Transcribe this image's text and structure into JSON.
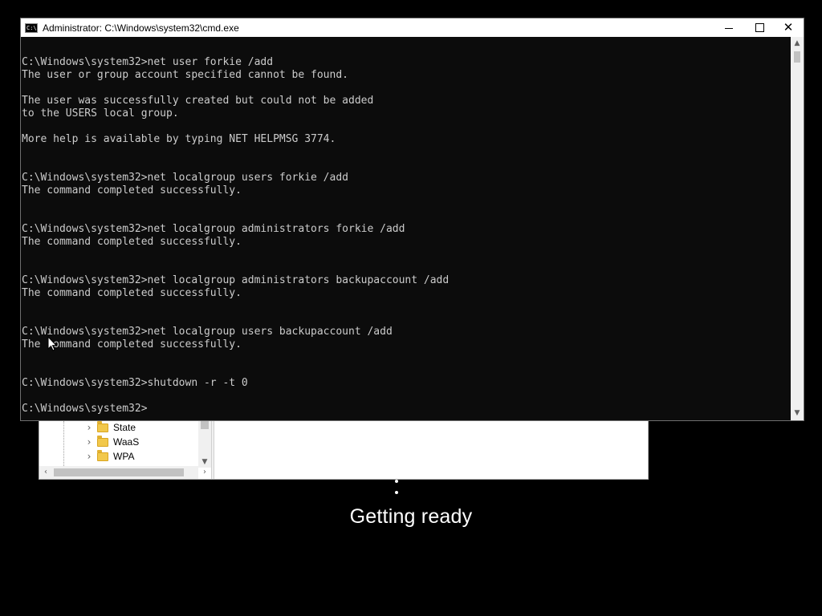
{
  "cmd_window": {
    "title": "Administrator: C:\\Windows\\system32\\cmd.exe",
    "icon": "cmd-icon",
    "icon_label": "C:\\",
    "controls": {
      "minimize": "minimize-icon",
      "maximize": "maximize-icon",
      "close_glyph": "✕"
    },
    "console_lines": [
      "",
      "C:\\Windows\\system32>net user forkie /add",
      "The user or group account specified cannot be found.",
      "",
      "The user was successfully created but could not be added",
      "to the USERS local group.",
      "",
      "More help is available by typing NET HELPMSG 3774.",
      "",
      "",
      "C:\\Windows\\system32>net localgroup users forkie /add",
      "The command completed successfully.",
      "",
      "",
      "C:\\Windows\\system32>net localgroup administrators forkie /add",
      "The command completed successfully.",
      "",
      "",
      "C:\\Windows\\system32>net localgroup administrators backupaccount /add",
      "The command completed successfully.",
      "",
      "",
      "C:\\Windows\\system32>net localgroup users backupaccount /add",
      "The command completed successfully.",
      "",
      "",
      "C:\\Windows\\system32>shutdown -r -t 0",
      "",
      "C:\\Windows\\system32>"
    ],
    "colors": {
      "background": "#0c0c0c",
      "text": "#cccccc"
    }
  },
  "regedit": {
    "tree_items": [
      {
        "label": "State",
        "icon": "folder-icon"
      },
      {
        "label": "WaaS",
        "icon": "folder-icon"
      },
      {
        "label": "WPA",
        "icon": "folder-icon"
      }
    ],
    "chevron_glyph": "›"
  },
  "restart_screen": {
    "status_text": "Getting ready"
  }
}
